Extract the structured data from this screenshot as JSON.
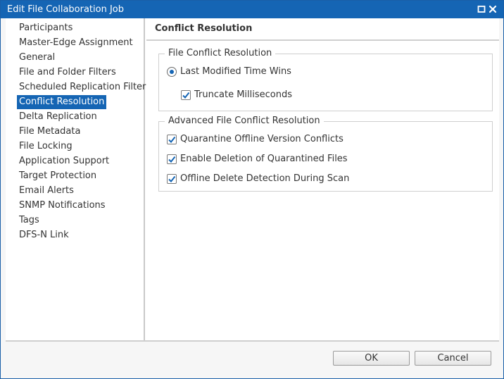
{
  "window": {
    "title": "Edit File Collaboration Job",
    "accent_color": "#1565b4",
    "maximize_icon": "maximize-icon",
    "close_icon": "close-icon"
  },
  "nav": {
    "selected": "Conflict Resolution",
    "items": [
      "Participants",
      "Master-Edge Assignment",
      "General",
      "File and Folder Filters",
      "Scheduled Replication Filters",
      "Conflict Resolution",
      "Delta Replication",
      "File Metadata",
      "File Locking",
      "Application Support",
      "Target Protection",
      "Email Alerts",
      "SNMP Notifications",
      "Tags",
      "DFS-N Link"
    ]
  },
  "panel": {
    "title": "Conflict Resolution",
    "file_conflict": {
      "legend": "File Conflict Resolution",
      "last_modified": {
        "label": "Last Modified Time Wins",
        "selected": true
      },
      "truncate_ms": {
        "label": "Truncate Milliseconds",
        "checked": true
      }
    },
    "advanced": {
      "legend": "Advanced File Conflict Resolution",
      "options": [
        {
          "label": "Quarantine Offline Version Conflicts",
          "checked": true
        },
        {
          "label": "Enable Deletion of Quarantined Files",
          "checked": true
        },
        {
          "label": "Offline Delete Detection During Scan",
          "checked": true
        }
      ]
    }
  },
  "footer": {
    "ok_label": "OK",
    "cancel_label": "Cancel"
  }
}
